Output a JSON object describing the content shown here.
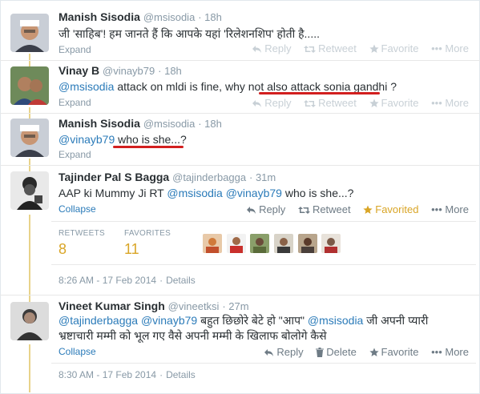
{
  "tweets": [
    {
      "name": "Manish Sisodia",
      "handle": "@msisodia",
      "time": "18h",
      "text": "जी 'साहिब'! हम जानते हैं कि आपके यहां 'रिलेशनशिप' होती है.....",
      "expand": "Expand"
    },
    {
      "name": "Vinay B",
      "handle": "@vinayb79",
      "time": "18h",
      "mention": "@msisodia",
      "text_a": " attack on mldi is fine, why not also ",
      "text_b": "attack sonia gandhi",
      "text_c": " ?",
      "expand": "Expand"
    },
    {
      "name": "Manish Sisodia",
      "handle": "@msisodia",
      "time": "18h",
      "mention": "@vinayb79",
      "text_b": " who is she...?",
      "expand": "Expand"
    },
    {
      "name": "Tajinder Pal S Bagga",
      "handle": "@tajinderbagga",
      "time": "31m",
      "text_a": "AAP ki Mummy Ji RT ",
      "mention1": "@msisodia",
      "mention2": "@vinayb79",
      "text_b": " who is she...?",
      "collapse": "Collapse",
      "retweets_label": "RETWEETS",
      "retweets_value": "8",
      "favorites_label": "FAVORITES",
      "favorites_value": "11",
      "timestamp": "8:26 AM - 17 Feb 2014",
      "details": "Details"
    },
    {
      "name": "Vineet Kumar Singh",
      "handle": "@vineetksi",
      "time": "27m",
      "mention1": "@tajinderbagga",
      "mention2": "@vinayb79",
      "text_a": " बहुत छिछोरे बेटे हो \"आप\" ",
      "mention3": "@msisodia",
      "text_b": " जी अपनी प्यारी",
      "line2": "भ्रष्टाचारी मम्मी को भूल गए वैसे अपनी मम्मी के खिलाफ बोलोगे कैसे",
      "collapse": "Collapse",
      "timestamp": "8:30 AM - 17 Feb 2014",
      "details": "Details"
    }
  ],
  "actions": {
    "reply": "Reply",
    "retweet": "Retweet",
    "favorite": "Favorite",
    "favorited": "Favorited",
    "delete": "Delete",
    "more": "More"
  },
  "colors": {
    "link": "#2b7bb9",
    "gold": "#d9a526",
    "underline": "#d21f1f",
    "thread": "#e8d38a"
  },
  "icons": [
    "reply-icon",
    "retweet-icon",
    "favorite-star-icon",
    "more-dots-icon",
    "delete-trash-icon"
  ]
}
